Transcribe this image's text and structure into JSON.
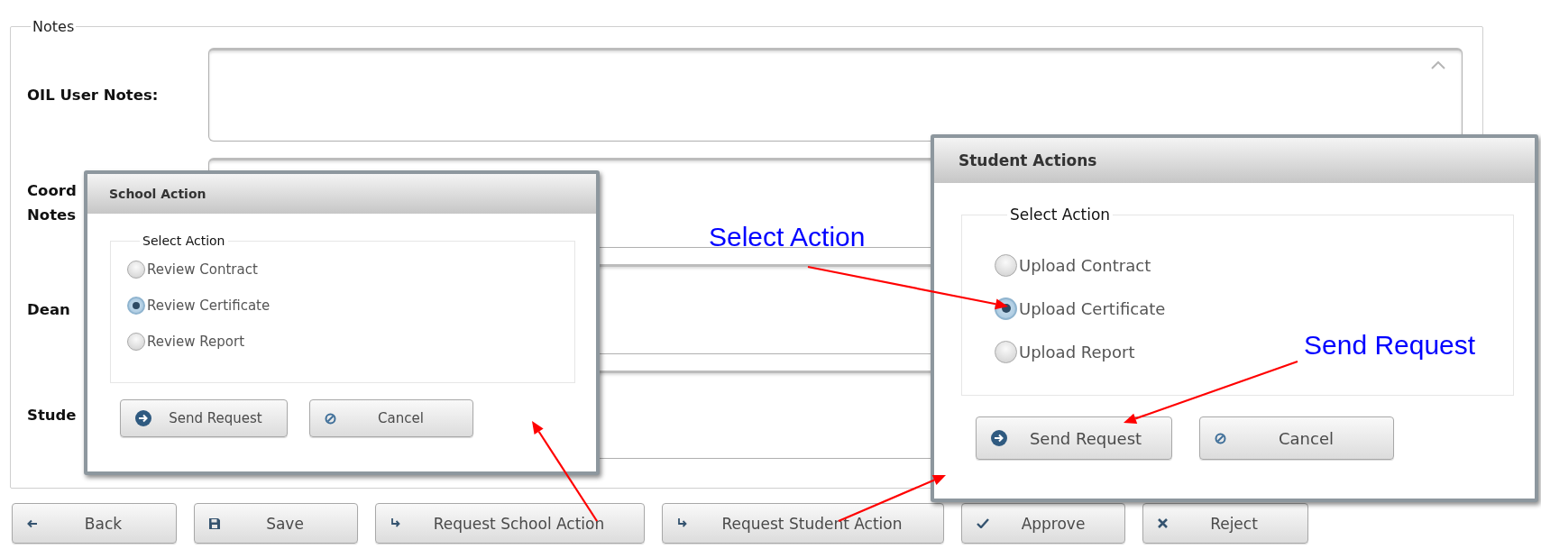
{
  "notes": {
    "legend": "Notes",
    "fields": [
      {
        "label_lines": [
          "OIL User Notes:"
        ]
      },
      {
        "label_lines": [
          "Coord",
          "Notes"
        ]
      },
      {
        "label_lines": [
          "Dean"
        ]
      },
      {
        "label_lines": [
          "Stude"
        ]
      }
    ]
  },
  "school_dialog": {
    "title": "School Action",
    "group_label": "Select Action",
    "options": [
      {
        "label": "Review Contract",
        "selected": false
      },
      {
        "label": "Review Certificate",
        "selected": true
      },
      {
        "label": "Review Report",
        "selected": false
      }
    ],
    "buttons": [
      {
        "label": "Send Request",
        "kind": "send"
      },
      {
        "label": "Cancel",
        "kind": "cancel"
      }
    ]
  },
  "student_dialog": {
    "title": "Student Actions",
    "group_label": "Select Action",
    "options": [
      {
        "label": "Upload Contract",
        "selected": false
      },
      {
        "label": "Upload Certificate",
        "selected": true
      },
      {
        "label": "Upload Report",
        "selected": false
      }
    ],
    "buttons": [
      {
        "label": "Send Request",
        "kind": "send"
      },
      {
        "label": "Cancel",
        "kind": "cancel"
      }
    ]
  },
  "toolbar": {
    "buttons": [
      {
        "label": "Back",
        "kind": "back"
      },
      {
        "label": "Save",
        "kind": "save"
      },
      {
        "label": "Request School Action",
        "kind": "forward"
      },
      {
        "label": "Request Student Action",
        "kind": "forward"
      },
      {
        "label": "Approve",
        "kind": "approve"
      },
      {
        "label": "Reject",
        "kind": "reject"
      }
    ]
  },
  "callouts": [
    {
      "text": "Select Action"
    },
    {
      "text": "Send Request"
    }
  ]
}
